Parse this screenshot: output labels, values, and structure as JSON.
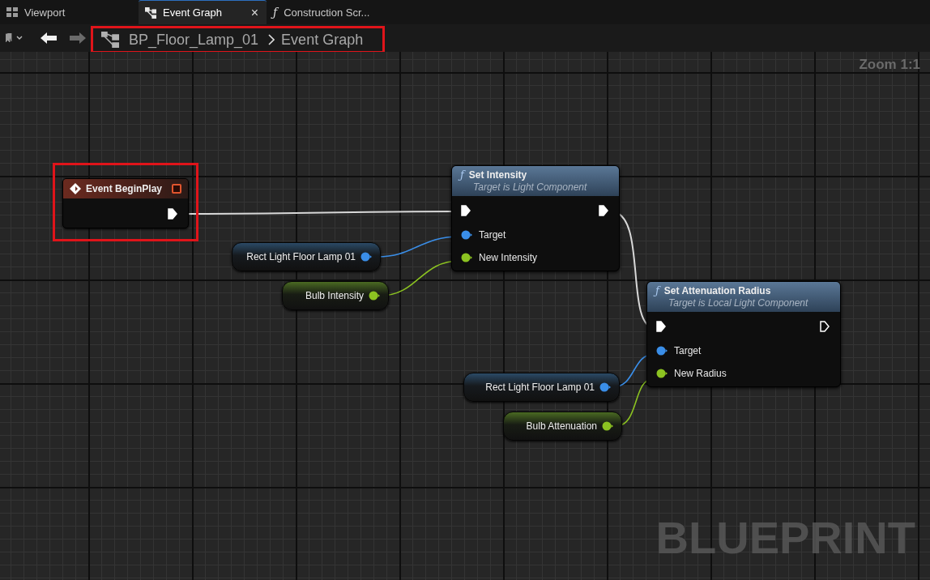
{
  "tabs": [
    {
      "label": "Viewport",
      "selected": false
    },
    {
      "label": "Event Graph",
      "selected": true,
      "close_glyph": "×"
    },
    {
      "label": "Construction Scr...",
      "glyph": "ƒ",
      "selected": false
    }
  ],
  "toolbar": {
    "back_disabled": false,
    "forward_disabled": true,
    "breadcrumb": [
      "BP_Floor_Lamp_01",
      "Event Graph"
    ]
  },
  "zoom": "Zoom 1:1",
  "nodes": [
    {
      "kind": "event",
      "title": "Event BeginPlay",
      "exec_out_connected": true
    },
    {
      "kind": "variable",
      "label": "Rect Light Floor Lamp 01",
      "pin": {
        "kind": "object"
      }
    },
    {
      "kind": "variable",
      "label": "Bulb Intensity",
      "pin": {
        "kind": "float"
      }
    },
    {
      "kind": "function",
      "glyph": "ƒ",
      "title": "Set Intensity",
      "subtitle": "Target is Light Component",
      "exec_in_connected": true,
      "exec_out_connected": true,
      "inputs": [
        {
          "kind": "object",
          "label": "Target"
        },
        {
          "kind": "float",
          "label": "New Intensity"
        }
      ]
    },
    {
      "kind": "variable",
      "label": "Rect Light Floor Lamp 01",
      "pin": {
        "kind": "object"
      }
    },
    {
      "kind": "variable",
      "label": "Bulb Attenuation",
      "pin": {
        "kind": "float"
      }
    },
    {
      "kind": "function",
      "glyph": "ƒ",
      "title": "Set Attenuation Radius",
      "subtitle": "Target is Local Light Component",
      "exec_in_connected": true,
      "exec_out_connected": false,
      "inputs": [
        {
          "kind": "object",
          "label": "Target"
        },
        {
          "kind": "float",
          "label": "New Radius"
        }
      ]
    }
  ],
  "wires": [
    {
      "kind": "exec"
    },
    {
      "kind": "exec"
    },
    {
      "kind": "object"
    },
    {
      "kind": "float"
    },
    {
      "kind": "object"
    },
    {
      "kind": "float"
    }
  ],
  "watermark": "BLUEPRINT"
}
